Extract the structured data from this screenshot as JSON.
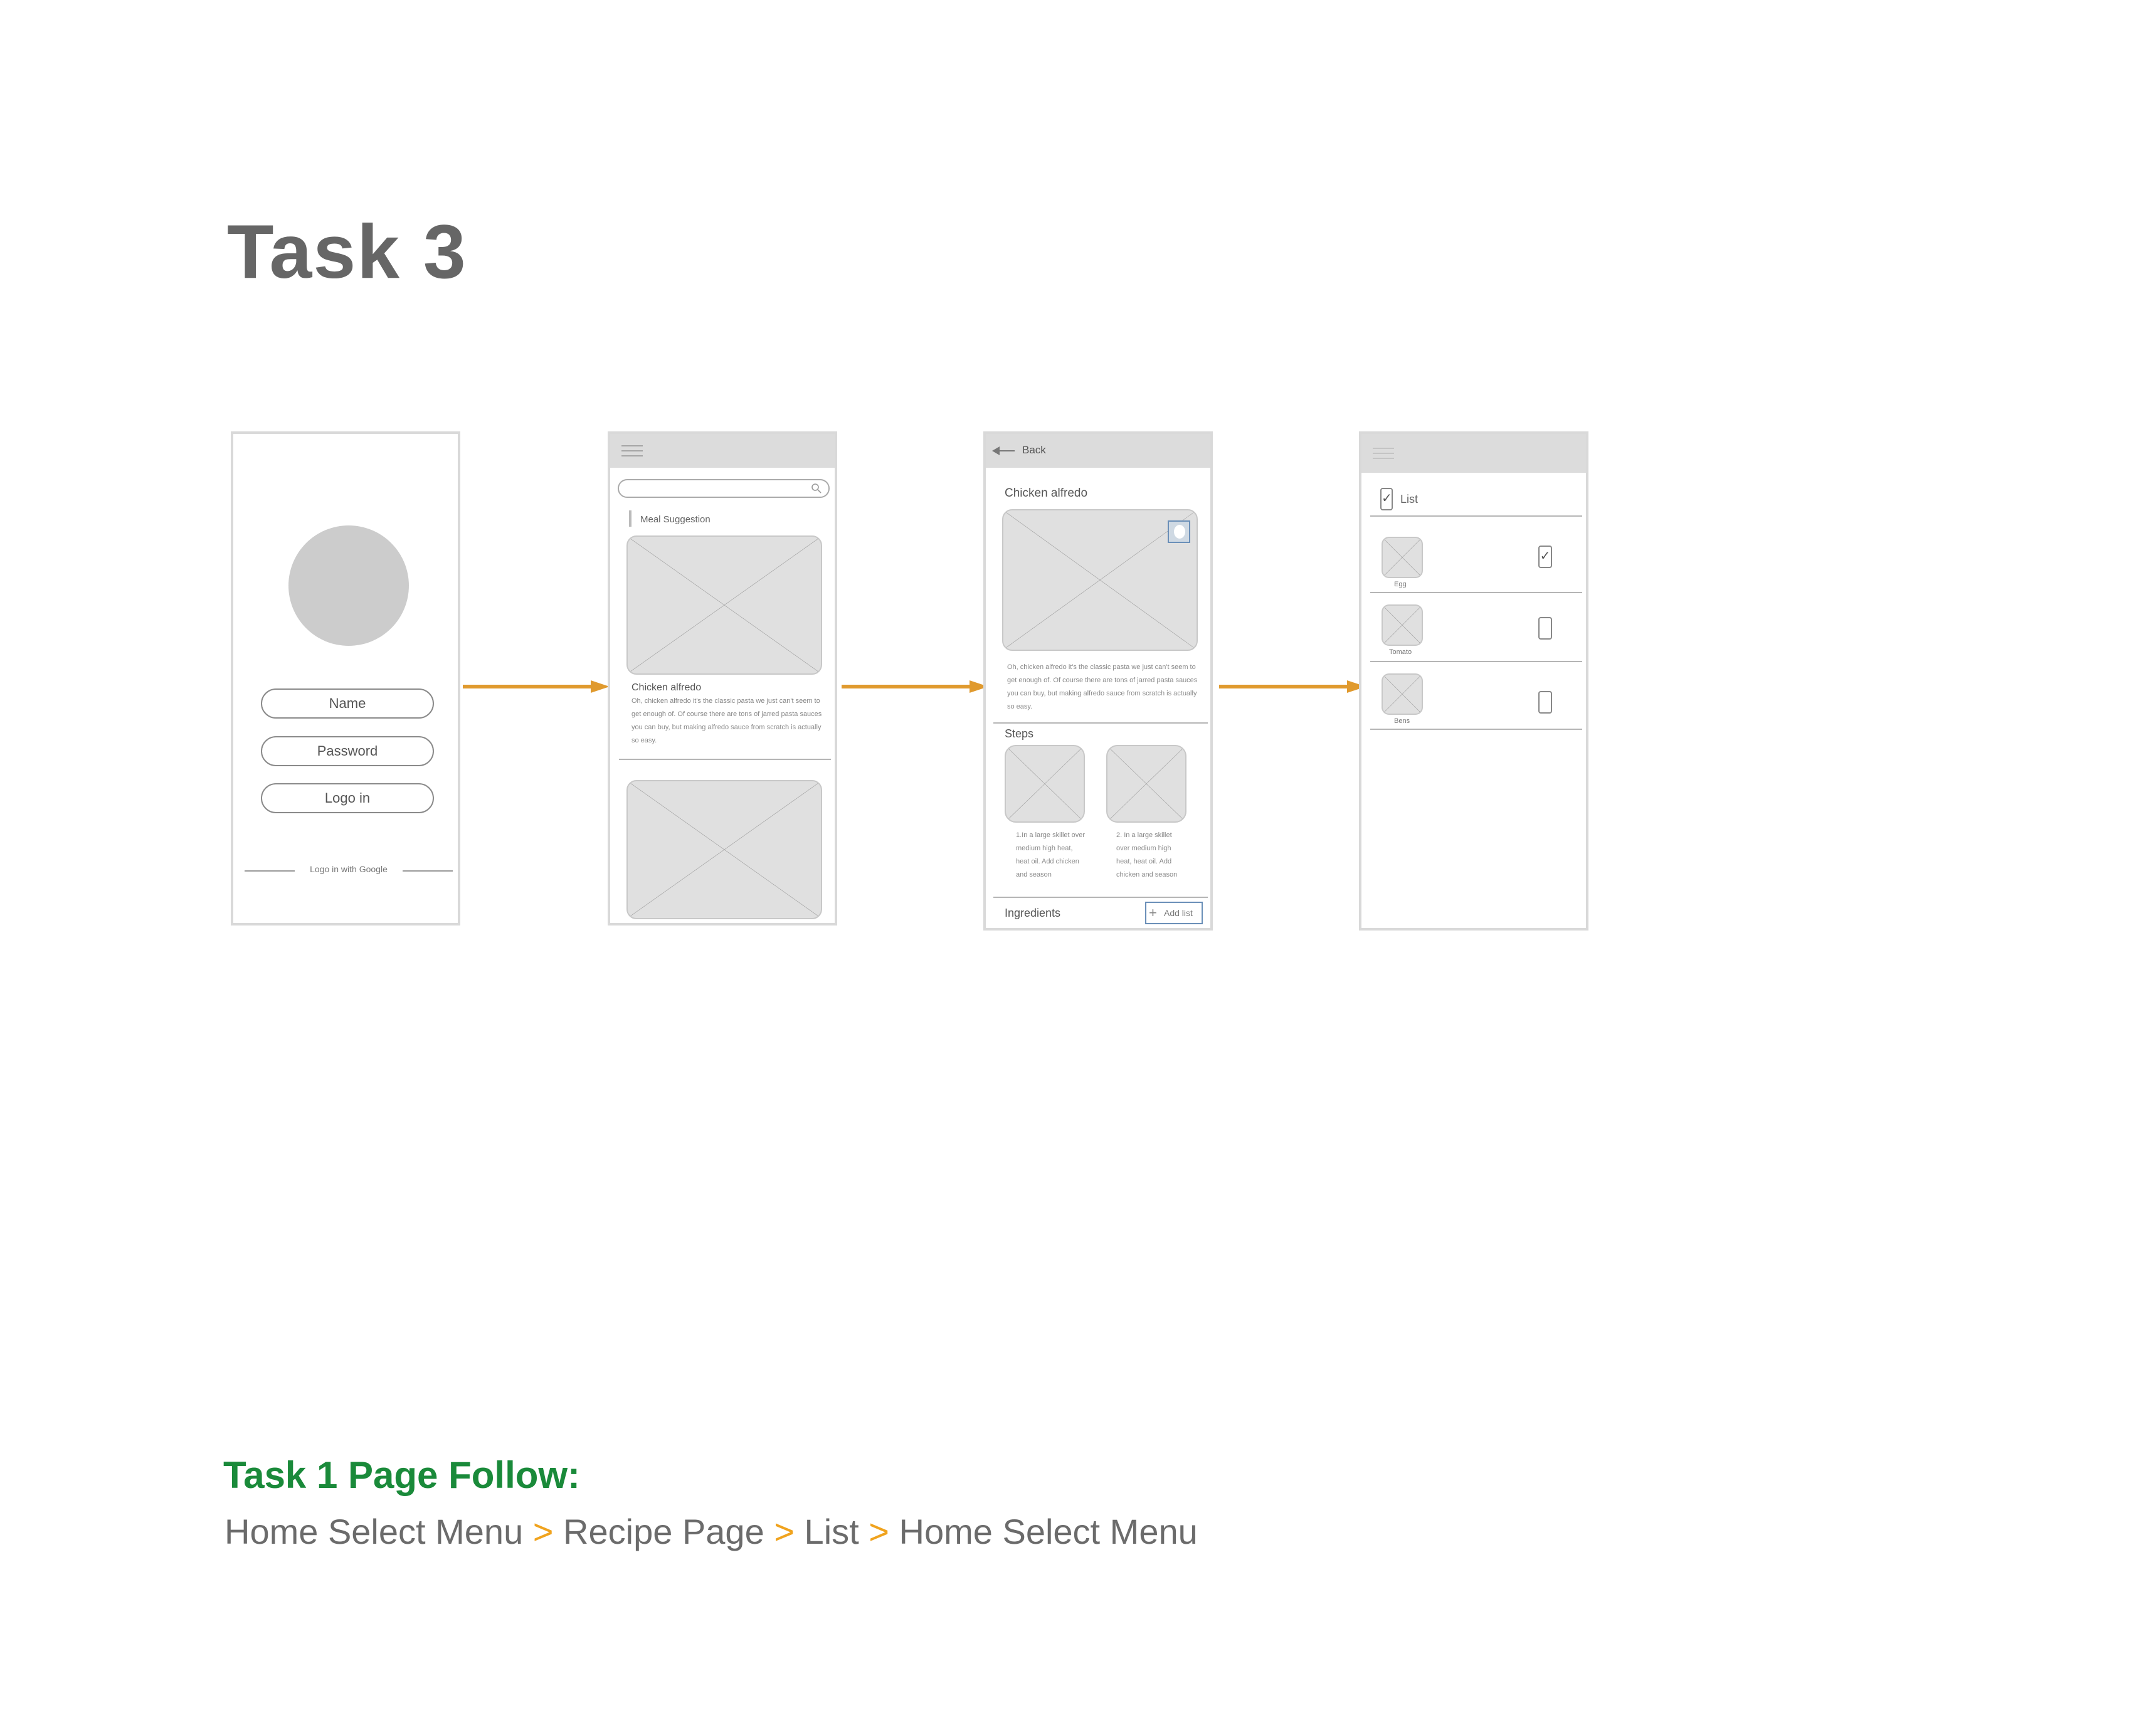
{
  "heading": "Task 3",
  "screen1": {
    "name_field": "Name",
    "password_field": "Password",
    "login_button": "Logo in",
    "google_login": "Logo in with Google"
  },
  "screen2": {
    "section_label": "Meal Suggestion",
    "card_title": "Chicken alfredo",
    "card_text": "Oh, chicken alfredo it's the classic pasta we just can't seem to get enough of. Of course there are tons of jarred pasta sauces you can buy, but making alfredo sauce from scratch is actually so easy."
  },
  "screen3": {
    "back_label": "Back",
    "recipe_title": "Chicken alfredo",
    "recipe_text": "Oh, chicken alfredo it's the classic pasta we just can't seem to get enough of. Of course there are tons of jarred pasta sauces you can buy, but making alfredo sauce from scratch is actually so easy.",
    "steps_label": "Steps",
    "step1": "1.In a large skillet over medium high heat, heat oil. Add chicken and season",
    "step2": "2. In a large skillet over medium high heat, heat oil. Add chicken and season",
    "ingredients_label": "Ingredients",
    "add_list_button": "Add list"
  },
  "screen4": {
    "list_label": "List",
    "items": [
      {
        "name": "Egg",
        "checked": true
      },
      {
        "name": "Tomato",
        "checked": false
      },
      {
        "name": "Bens",
        "checked": false
      }
    ]
  },
  "flow_title": "Task 1 Page Follow:",
  "flow_steps": [
    "Home Select Menu",
    "Recipe Page",
    "List",
    "Home Select Menu"
  ],
  "flow_separator": ">",
  "colors": {
    "heading": "#666666",
    "flow_title": "#1a8a3a",
    "arrow": "#e09a2e",
    "separator": "#f0a31e",
    "placeholder": "#e0e0e0"
  }
}
